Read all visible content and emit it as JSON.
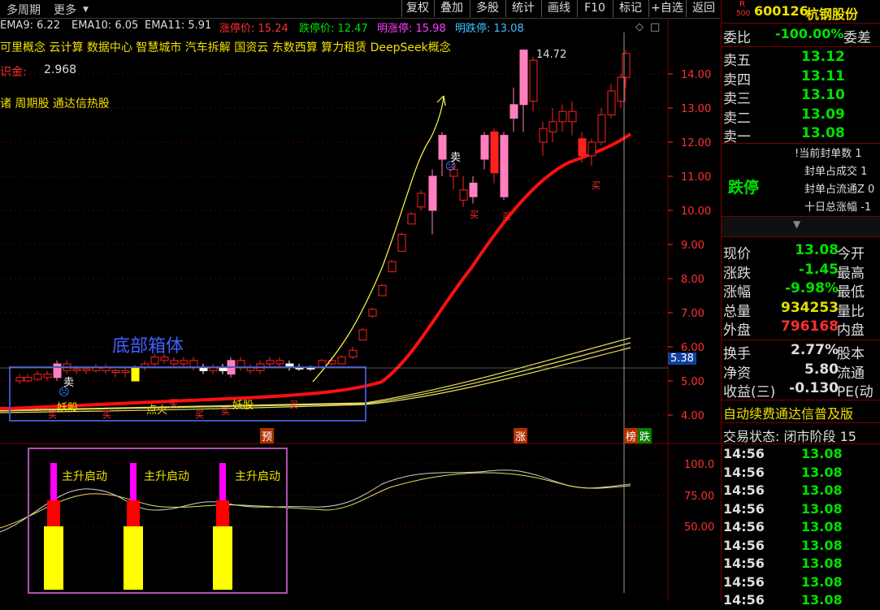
{
  "toolbar": {
    "period_label": "多周期",
    "more_label": "更多",
    "buttons": [
      "复权",
      "叠加",
      "多股",
      "统计",
      "画线",
      "F10",
      "标记",
      "+自选",
      "返回"
    ]
  },
  "indicators": {
    "ema9": "EMA9: 6.22",
    "ema10": "EMA10: 6.05",
    "ema11": "EMA11: 5.91",
    "limit_up": "涨停价: 15.24",
    "limit_down": "跌停价: 12.47",
    "next_up": "明涨停: 15.98",
    "next_down": "明跌停: 13.08"
  },
  "concepts_line": "可里概念 云计算 数据中心 智慧城市 汽车拆解 国资云 东数西算 算力租赁 DeepSeek概念",
  "fund_label": "识金:",
  "fund_value": "2.968",
  "tags_line": "诸 周期股 通达信热股",
  "annotations": {
    "box_label": "底部箱体",
    "max_price": "14.72",
    "sell1": "卖",
    "sell2": "卖",
    "buy_marks": [
      "买",
      "买",
      "买",
      "买",
      "买",
      "买",
      "买",
      "买",
      "买"
    ],
    "small_labels": [
      "妖股",
      "点火",
      "妖股"
    ],
    "mark_yu": "预",
    "mark_zhang": "涨",
    "mark_bang": "榜",
    "mark_die": "跌",
    "cursor_price": "5.38",
    "launch_label": "主升启动"
  },
  "y_axis_main": [
    "14.00",
    "13.00",
    "12.00",
    "11.00",
    "10.00",
    "9.00",
    "8.00",
    "7.00",
    "6.00",
    "5.00",
    "4.00"
  ],
  "y_axis_sub": [
    "100.0",
    "75.00",
    "50.00"
  ],
  "stock": {
    "code_prefix_top": "R",
    "code_prefix_bottom": "500",
    "code": "600126",
    "name": "杭钢股份"
  },
  "quote": {
    "weibi_label": "委比",
    "weibi_value": "-100.00%",
    "weicha_label": "委差",
    "asks": [
      {
        "label": "卖五",
        "price": "13.12"
      },
      {
        "label": "卖四",
        "price": "13.11"
      },
      {
        "label": "卖三",
        "price": "13.10"
      },
      {
        "label": "卖二",
        "price": "13.09"
      },
      {
        "label": "卖一",
        "price": "13.08"
      }
    ],
    "limit_status": "跌停",
    "seal_info": [
      "!当前封单数 1",
      "封单占成交 1",
      "封单占流通Z 0",
      "十日总涨幅 -1"
    ],
    "stats": [
      {
        "label": "现价",
        "value": "13.08",
        "label2": "今开",
        "color": "#00e000"
      },
      {
        "label": "涨跌",
        "value": "-1.45",
        "label2": "最高",
        "color": "#00e000"
      },
      {
        "label": "涨幅",
        "value": "-9.98%",
        "label2": "最低",
        "color": "#00e000"
      },
      {
        "label": "总量",
        "value": "934253",
        "label2": "量比",
        "color": "#e0e000"
      },
      {
        "label": "外盘",
        "value": "796168",
        "label2": "内盘",
        "color": "#ff3030"
      }
    ],
    "stats2": [
      {
        "label": "换手",
        "value": "2.77%",
        "label2": "股本",
        "color": "#ddd"
      },
      {
        "label": "净资",
        "value": "5.80",
        "label2": "流通",
        "color": "#ddd"
      },
      {
        "label": "收益(三)",
        "value": "-0.130",
        "label2": "PE(动",
        "color": "#ddd"
      }
    ],
    "ad_text": "自动续费通达信普及版",
    "trade_state": "交易状态: 闭市阶段 15",
    "ticks": [
      {
        "time": "14:56",
        "price": "13.08"
      },
      {
        "time": "14:56",
        "price": "13.08"
      },
      {
        "time": "14:56",
        "price": "13.08"
      },
      {
        "time": "14:56",
        "price": "13.08"
      },
      {
        "time": "14:56",
        "price": "13.08"
      },
      {
        "time": "14:56",
        "price": "13.08"
      },
      {
        "time": "14:56",
        "price": "13.08"
      },
      {
        "time": "14:56",
        "price": "13.08"
      },
      {
        "time": "14:56",
        "price": "13.08"
      }
    ]
  },
  "colors": {
    "up": "#ff2020",
    "down": "#00e000",
    "ema_red": "#ff1010",
    "ema_yellow": "#e8e060",
    "pink": "#ff7fbf",
    "magenta": "#ff00ff",
    "box_blue": "#4050c0",
    "box_purple": "#b050b0"
  }
}
